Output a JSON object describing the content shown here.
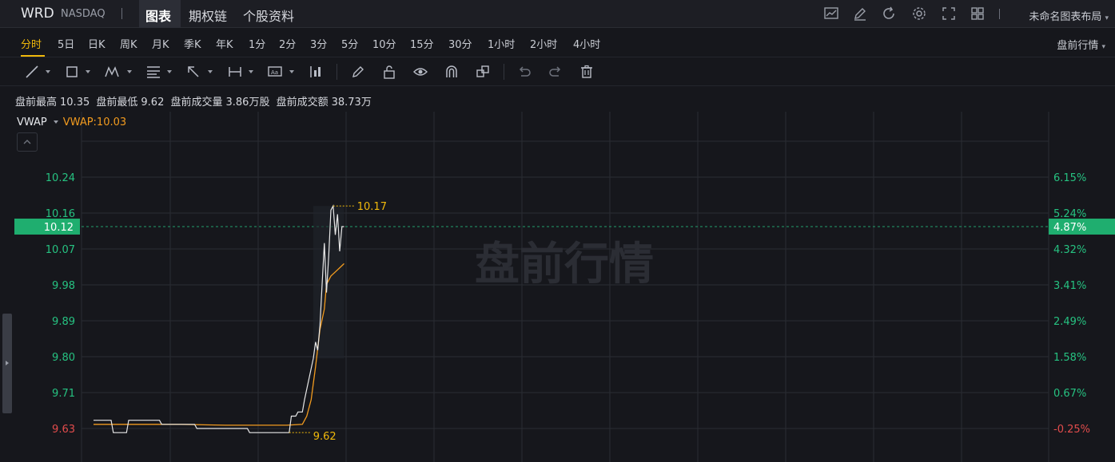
{
  "header": {
    "ticker": "WRD",
    "exchange": "NASDAQ",
    "tabs": [
      "图表",
      "期权链",
      "个股资料"
    ],
    "active_tab": "图表",
    "layout_name": "未命名图表布局",
    "icons": [
      "chart-icon",
      "edit-icon",
      "refresh-icon",
      "settings-icon",
      "fullscreen-icon",
      "grid-layout-icon"
    ]
  },
  "timeframes": {
    "items": [
      "分时",
      "5日",
      "日K",
      "周K",
      "月K",
      "季K",
      "年K",
      "1分",
      "2分",
      "3分",
      "5分",
      "10分",
      "15分",
      "30分",
      "1小时",
      "2小时",
      "4小时"
    ],
    "active": "分时",
    "market_selector": "盘前行情"
  },
  "drawing_tools": [
    "line-tool-icon",
    "rectangle-tool-icon",
    "pattern-tool-icon",
    "fibonacci-tool-icon",
    "arrow-tool-icon",
    "measure-tool-icon",
    "text-tool-icon",
    "indicator-tool-icon",
    "pencil-icon",
    "unlock-icon",
    "eye-icon",
    "magnet-icon",
    "copy-icon",
    "undo-icon",
    "redo-icon",
    "trash-icon"
  ],
  "stats": {
    "high_label": "盘前最高",
    "high": "10.35",
    "low_label": "盘前最低",
    "low": "9.62",
    "volume_label": "盘前成交量",
    "volume": "3.86万股",
    "turnover_label": "盘前成交额",
    "turnover": "38.73万"
  },
  "indicator": {
    "name": "VWAP",
    "value_label": "VWAP:10.03"
  },
  "watermark": "盘前行情",
  "colors": {
    "up": "#26c281",
    "down": "#e24c4c",
    "price_line": "#e8e8e8",
    "vwap_line": "#f29b1f",
    "accent": "#f0b90b",
    "current_price_bg": "#1fae6f"
  },
  "chart_data": {
    "type": "line",
    "y_ticks_left": [
      "10.24",
      "10.16",
      "10.07",
      "9.98",
      "9.89",
      "9.80",
      "9.71",
      "9.63"
    ],
    "y_ticks_right": [
      "6.15%",
      "5.24%",
      "4.32%",
      "3.41%",
      "2.49%",
      "1.58%",
      "0.67%",
      "-0.25%"
    ],
    "current_price": "10.12",
    "current_pct": "4.87%",
    "max_label": "10.17",
    "min_label": "9.62",
    "ylim": [
      9.6,
      10.3
    ],
    "x_total": 120,
    "series": [
      {
        "name": "price",
        "points": [
          [
            0,
            9.65
          ],
          [
            8,
            9.65
          ],
          [
            9,
            9.62
          ],
          [
            15,
            9.62
          ],
          [
            16,
            9.65
          ],
          [
            30,
            9.65
          ],
          [
            31,
            9.64
          ],
          [
            46,
            9.64
          ],
          [
            47,
            9.63
          ],
          [
            70,
            9.63
          ],
          [
            71,
            9.62
          ],
          [
            89,
            9.62
          ],
          [
            90,
            9.66
          ],
          [
            92,
            9.66
          ],
          [
            93,
            9.67
          ],
          [
            95,
            9.67
          ],
          [
            96,
            9.7
          ],
          [
            98,
            9.75
          ],
          [
            100,
            9.8
          ],
          [
            101,
            9.84
          ],
          [
            102,
            9.82
          ],
          [
            103,
            9.88
          ],
          [
            104,
            9.98
          ],
          [
            105,
            10.08
          ],
          [
            106,
            9.96
          ],
          [
            107,
            10.05
          ],
          [
            108,
            10.16
          ],
          [
            109,
            10.17
          ],
          [
            110,
            10.1
          ],
          [
            111,
            10.15
          ],
          [
            112,
            10.06
          ],
          [
            113,
            10.12
          ],
          [
            114,
            10.12
          ]
        ]
      },
      {
        "name": "vwap",
        "points": [
          [
            0,
            9.64
          ],
          [
            20,
            9.64
          ],
          [
            40,
            9.64
          ],
          [
            60,
            9.638
          ],
          [
            88,
            9.638
          ],
          [
            95,
            9.64
          ],
          [
            97,
            9.66
          ],
          [
            99,
            9.7
          ],
          [
            101,
            9.78
          ],
          [
            103,
            9.87
          ],
          [
            105,
            9.92
          ],
          [
            106,
            9.98
          ],
          [
            108,
            10.0
          ],
          [
            110,
            10.01
          ],
          [
            112,
            10.02
          ],
          [
            114,
            10.03
          ]
        ]
      }
    ]
  }
}
